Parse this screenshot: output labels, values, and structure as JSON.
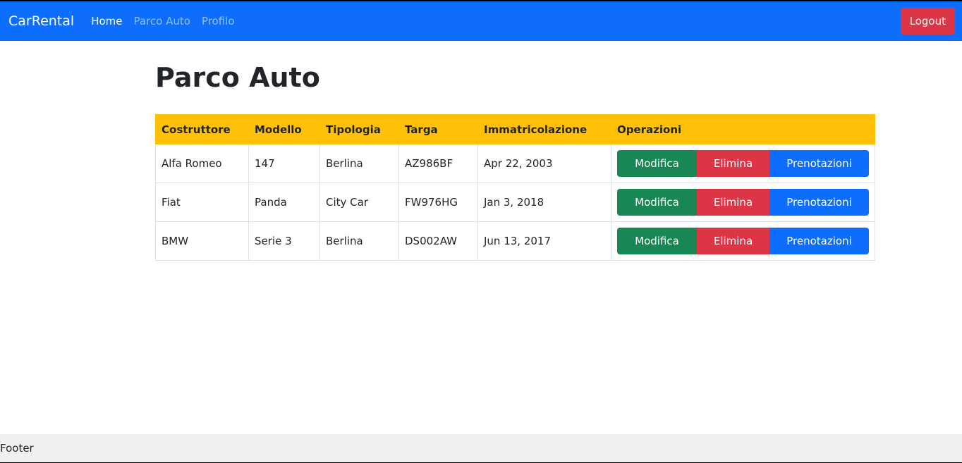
{
  "navbar": {
    "brand": "CarRental",
    "links": [
      {
        "label": "Home",
        "active": true
      },
      {
        "label": "Parco Auto",
        "active": false
      },
      {
        "label": "Profilo",
        "active": false
      }
    ],
    "logout_label": "Logout"
  },
  "page": {
    "title": "Parco Auto"
  },
  "table": {
    "headers": [
      "Costruttore",
      "Modello",
      "Tipologia",
      "Targa",
      "Immatricolazione",
      "Operazioni"
    ],
    "rows": [
      {
        "costruttore": "Alfa Romeo",
        "modello": "147",
        "tipologia": "Berlina",
        "targa": "AZ986BF",
        "immatricolazione": "Apr 22, 2003"
      },
      {
        "costruttore": "Fiat",
        "modello": "Panda",
        "tipologia": "City Car",
        "targa": "FW976HG",
        "immatricolazione": "Jan 3, 2018"
      },
      {
        "costruttore": "BMW",
        "modello": "Serie 3",
        "tipologia": "Berlina",
        "targa": "DS002AW",
        "immatricolazione": "Jun 13, 2017"
      }
    ],
    "actions": {
      "edit_label": "Modifica",
      "delete_label": "Elimina",
      "bookings_label": "Prenotazioni"
    }
  },
  "footer": {
    "text": "Footer"
  },
  "colors": {
    "navbar": "#0d6efd",
    "header_row": "#ffc107",
    "edit": "#198754",
    "delete": "#dc3545",
    "bookings": "#0d6efd"
  }
}
